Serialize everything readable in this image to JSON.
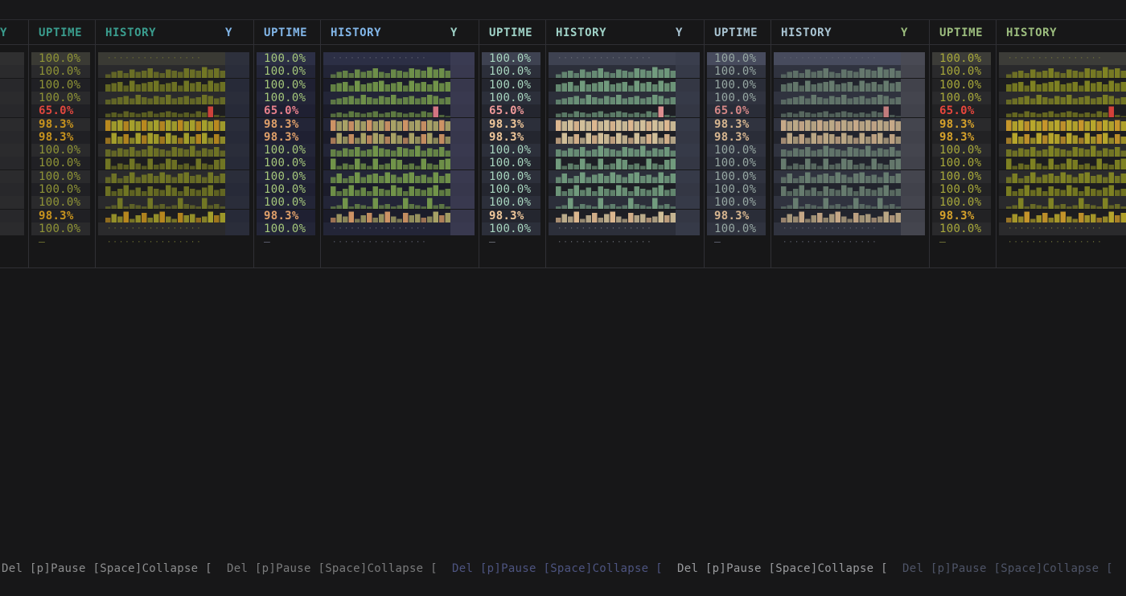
{
  "headers": {
    "uptime": "UPTIME",
    "history": "HISTORY",
    "clipped": "Y"
  },
  "footer_text": "Del [p]Pause [Space]Collapse [",
  "uptime_values": [
    "100.0%",
    "100.0%",
    "100.0%",
    "100.0%",
    "65.0%",
    "98.3%",
    "98.3%",
    "100.0%",
    "100.0%",
    "100.0%",
    "100.0%",
    "100.0%",
    "98.3%",
    "100.0%"
  ],
  "empty_value": "—",
  "history_dots": "················",
  "status_levels": [
    "ok",
    "ok",
    "ok",
    "ok",
    "down",
    "warn",
    "warn",
    "ok",
    "ok",
    "ok",
    "ok",
    "ok",
    "warn",
    "ok"
  ],
  "history_fill": [
    [
      0.05,
      0.05,
      0.05,
      0.05,
      0.05,
      0.05,
      0.05,
      0.05,
      0.05,
      0.05,
      0.05,
      0.05,
      0.05,
      0.05,
      0.05,
      0.05,
      0.05,
      0.05,
      0.05,
      0.05
    ],
    [
      0.3,
      0.5,
      0.6,
      0.4,
      0.7,
      0.5,
      0.6,
      0.8,
      0.5,
      0.4,
      0.7,
      0.6,
      0.5,
      0.8,
      0.7,
      0.6,
      0.9,
      0.7,
      0.8,
      0.6
    ],
    [
      0.6,
      0.7,
      0.8,
      0.5,
      0.9,
      0.6,
      0.7,
      0.8,
      0.9,
      0.6,
      0.7,
      0.8,
      0.5,
      0.9,
      0.7,
      0.8,
      0.6,
      0.9,
      0.7,
      0.8
    ],
    [
      0.4,
      0.5,
      0.6,
      0.7,
      0.5,
      0.8,
      0.6,
      0.5,
      0.7,
      0.6,
      0.8,
      0.5,
      0.6,
      0.7,
      0.5,
      0.6,
      0.8,
      0.7,
      0.5,
      0.6
    ],
    [
      0.3,
      0.4,
      0.3,
      0.5,
      0.4,
      0.3,
      0.4,
      0.5,
      0.3,
      0.4,
      0.5,
      0.4,
      0.3,
      0.4,
      0.3,
      0.5,
      0.4,
      0.9,
      0.2,
      0.1
    ],
    [
      0.9,
      0.8,
      0.9,
      0.8,
      0.9,
      0.8,
      0.9,
      0.8,
      0.9,
      0.8,
      0.9,
      0.8,
      0.9,
      0.8,
      0.9,
      0.8,
      0.9,
      0.8,
      0.9,
      0.8
    ],
    [
      0.5,
      0.9,
      0.6,
      0.8,
      0.5,
      0.9,
      0.7,
      0.9,
      0.8,
      0.6,
      0.9,
      0.7,
      0.5,
      0.9,
      0.6,
      0.8,
      0.9,
      0.5,
      0.8,
      0.6
    ],
    [
      0.6,
      0.5,
      0.7,
      0.6,
      0.8,
      0.5,
      0.6,
      0.9,
      0.7,
      0.6,
      0.5,
      0.8,
      0.7,
      0.6,
      0.9,
      0.5,
      0.7,
      0.6,
      0.8,
      0.5
    ],
    [
      0.9,
      0.3,
      0.5,
      0.4,
      0.9,
      0.5,
      0.3,
      0.9,
      0.4,
      0.5,
      0.9,
      0.8,
      0.4,
      0.5,
      0.3,
      0.9,
      0.5,
      0.4,
      0.8,
      0.9
    ],
    [
      0.5,
      0.8,
      0.4,
      0.6,
      0.9,
      0.5,
      0.7,
      0.8,
      0.6,
      0.9,
      0.7,
      0.5,
      0.8,
      0.9,
      0.6,
      0.7,
      0.5,
      0.9,
      0.6,
      0.8
    ],
    [
      0.8,
      0.4,
      0.6,
      0.9,
      0.5,
      0.7,
      0.4,
      0.8,
      0.6,
      0.5,
      0.9,
      0.7,
      0.4,
      0.8,
      0.6,
      0.5,
      0.7,
      0.9,
      0.5,
      0.6
    ],
    [
      0.2,
      0.3,
      0.9,
      0.2,
      0.4,
      0.3,
      0.2,
      0.9,
      0.3,
      0.4,
      0.2,
      0.3,
      0.9,
      0.4,
      0.3,
      0.2,
      0.9,
      0.3,
      0.4,
      0.2
    ],
    [
      0.4,
      0.7,
      0.5,
      0.9,
      0.3,
      0.6,
      0.8,
      0.4,
      0.7,
      0.9,
      0.5,
      0.3,
      0.8,
      0.6,
      0.7,
      0.4,
      0.5,
      0.9,
      0.6,
      0.8
    ],
    [
      0.05,
      0.05,
      0.05,
      0.05,
      0.05,
      0.05,
      0.05,
      0.05,
      0.05,
      0.05,
      0.05,
      0.05,
      0.05,
      0.05,
      0.05,
      0.05,
      0.05,
      0.05,
      0.05,
      0.05
    ]
  ],
  "themes": [
    {
      "name": "olive",
      "header": "#3a9d8e",
      "ok": "#8f9436",
      "warn": "#c9941e",
      "down": "#e0473e",
      "bar": "#7a7f24",
      "barBright": "#b3ad2c",
      "band": "#202024",
      "bandAlt": "#2a2a2c",
      "firstBand": "#3a3a34",
      "histBg": "#1d1d1f",
      "dim": "#6f7131",
      "footer": "#7a7b7c",
      "endBand": "#2a2e3e"
    },
    {
      "name": "lime",
      "header": "#82b6e8",
      "ok": "#a5c77a",
      "warn": "#e0a06a",
      "down": "#e8808c",
      "bar": "#7ba24c",
      "barBright": "#b7b06c",
      "band": "#1f2032",
      "bandAlt": "#232537",
      "firstBand": "#2c2f45",
      "histBg": "#1b1c2a",
      "dim": "#5e6070",
      "footer": "#4d5480",
      "endBand": "#3f3f55"
    },
    {
      "name": "mint",
      "header": "#9fd2c7",
      "ok": "#a8d5bf",
      "warn": "#f0c79a",
      "down": "#f09a9a",
      "bar": "#7aa987",
      "barBright": "#e3cfa5",
      "band": "#24262f",
      "bandAlt": "#2c2f3a",
      "firstBand": "#3e4251",
      "histBg": "#1e1f25",
      "dim": "#6a6d76",
      "footer": "#9a9b9e",
      "endBand": "#3a3d4c"
    },
    {
      "name": "slate",
      "header": "#a9c4d2",
      "ok": "#96a7a2",
      "warn": "#d7b690",
      "down": "#d48686",
      "bar": "#6e8575",
      "barBright": "#cbb58e",
      "band": "#2a2d38",
      "bandAlt": "#30333f",
      "firstBand": "#474b5d",
      "histBg": "#22242d",
      "dim": "#5f6270",
      "footer": "#4e5467",
      "endBand": "#4a4a52"
    },
    {
      "name": "gold",
      "header": "#9cbd7e",
      "ok": "#a8a93a",
      "warn": "#d7a22b",
      "down": "#e8463c",
      "bar": "#8a8d22",
      "barBright": "#c8b52c",
      "band": "#222224",
      "bandAlt": "#2a2a2c",
      "firstBand": "#3c3c38",
      "histBg": "#1d1d1f",
      "dim": "#717238",
      "footer": "#8d8e8f",
      "endBand": "#2c2c2e"
    }
  ]
}
